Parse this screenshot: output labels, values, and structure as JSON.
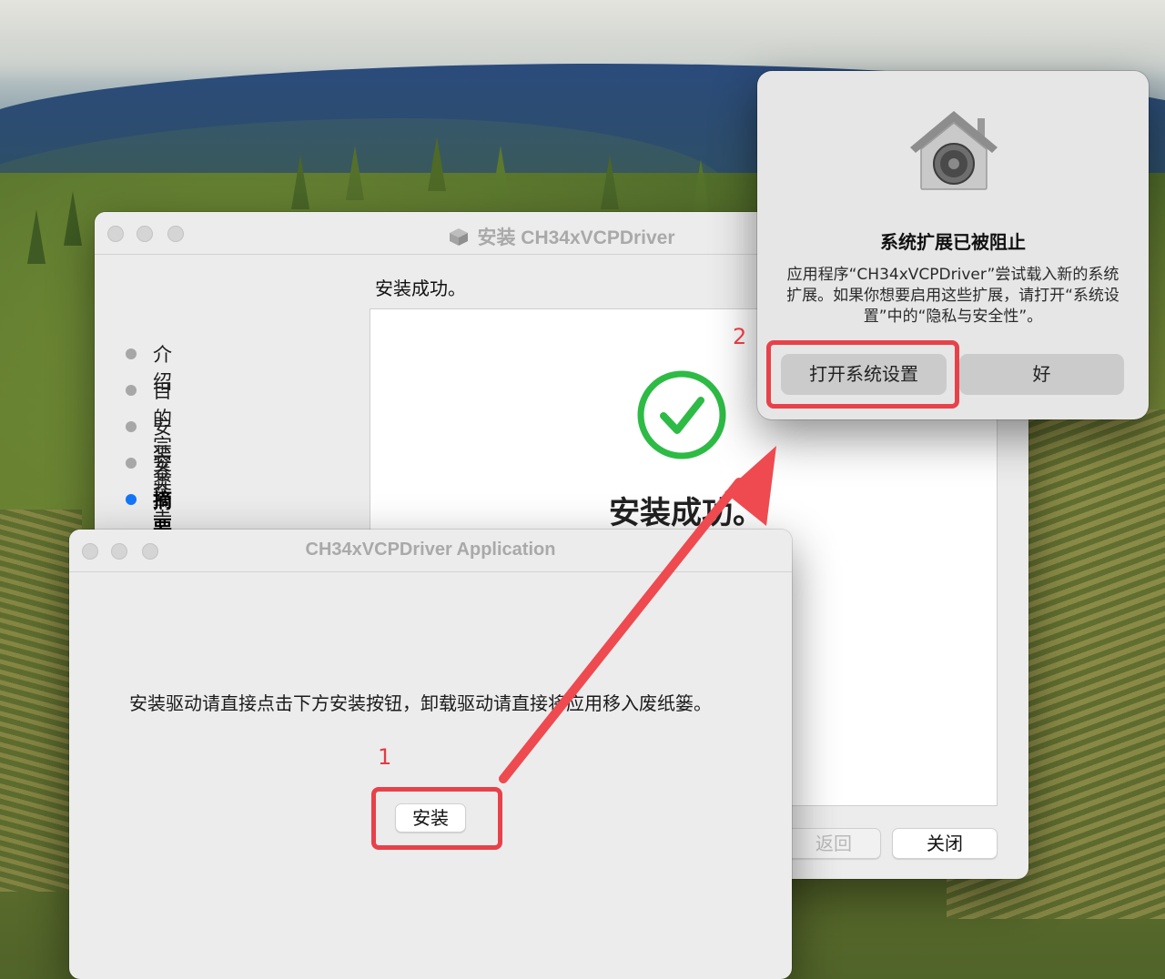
{
  "installer": {
    "title": "安装 CH34xVCPDriver",
    "heading": "安装成功。",
    "steps": [
      {
        "label": "介绍"
      },
      {
        "label": "目的宗卷"
      },
      {
        "label": "安装类型"
      },
      {
        "label": "安装"
      },
      {
        "label": "摘要"
      }
    ],
    "active_step": "摘要",
    "success_text": "安装成功。",
    "back_label": "返回",
    "close_label": "关闭"
  },
  "app": {
    "title": "CH34xVCPDriver Application",
    "instructions": "安装驱动请直接点击下方安装按钮，卸载驱动请直接将应用移入废纸篓。",
    "install_label": "安装"
  },
  "alert": {
    "title": "系统扩展已被阻止",
    "message": "应用程序“CH34xVCPDriver”尝试载入新的系统扩展。如果你想要启用这些扩展，请打开“系统设置”中的“隐私与安全性”。",
    "open_settings_label": "打开系统设置",
    "ok_label": "好",
    "icon": "security-house-lock-icon"
  },
  "annotations": {
    "label_1": "1",
    "label_2": "2",
    "color": "#e8414a"
  },
  "colors": {
    "active_step_dot": "#1476f5",
    "success_green": "#2dbb45"
  }
}
